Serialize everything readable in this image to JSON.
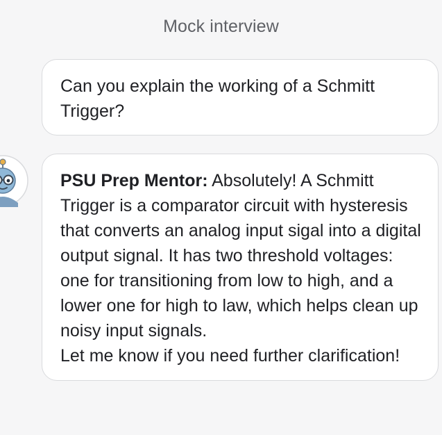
{
  "header": {
    "title": "Mock interview"
  },
  "messages": {
    "user": {
      "text": "Can you explain the working of a Schmitt Trigger?"
    },
    "mentor": {
      "sender": "PSU Prep Mentor:",
      "text": "Absolutely! A Schmitt Trigger is a comparator circuit with hysteresis that converts an analog input sigal into a digital output signal. It has two threshold voltages: one for transitioning from low to high, and a lower one for high to law, which helps clean up noisy input signals.",
      "closing": "Let me know if you need further clarification!"
    }
  },
  "colors": {
    "background": "#f6f6f7",
    "bubble": "#ffffff",
    "bubble_border": "#d9dadd",
    "text": "#1f2024",
    "header_text": "#5f6166",
    "avatar_skin": "#8fb8d8",
    "avatar_accent": "#e8b04a"
  },
  "icons": {
    "avatar": "robot-mentor-avatar"
  }
}
